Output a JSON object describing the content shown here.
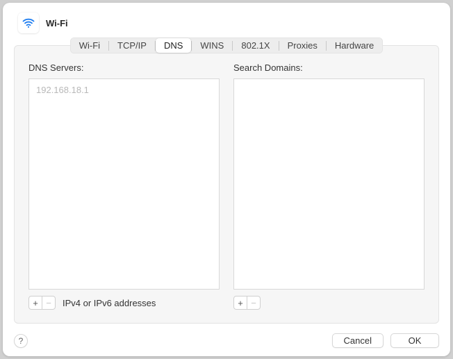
{
  "title": "Wi-Fi",
  "tabs": {
    "wifi": "Wi-Fi",
    "tcpip": "TCP/IP",
    "dns": "DNS",
    "wins": "WINS",
    "dot1x": "802.1X",
    "proxies": "Proxies",
    "hardware": "Hardware"
  },
  "active_tab": "dns",
  "dns": {
    "servers_label": "DNS Servers:",
    "servers": [
      "192.168.18.1"
    ],
    "servers_hint": "IPv4 or IPv6 addresses",
    "domains_label": "Search Domains:",
    "domains": []
  },
  "buttons": {
    "add": "+",
    "remove": "−",
    "help": "?",
    "cancel": "Cancel",
    "ok": "OK"
  }
}
